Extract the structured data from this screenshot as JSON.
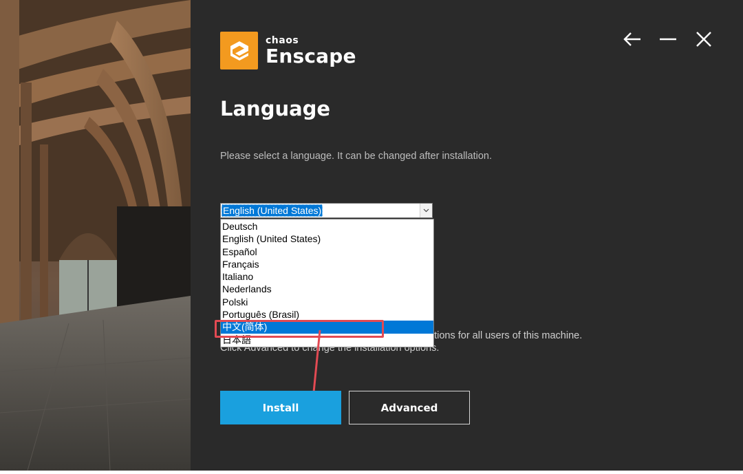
{
  "brand": {
    "company": "chaos",
    "product": "Enscape",
    "accent_color": "#f39a1f",
    "logo_icon": "enscape-logo-icon"
  },
  "window_controls": {
    "back_icon": "arrow-left-icon",
    "minimize_icon": "minimize-icon",
    "close_icon": "close-icon"
  },
  "page": {
    "title": "Language",
    "subtitle": "Please select a language. It can be changed after installation."
  },
  "language_select": {
    "selected": "English (United States)",
    "options": [
      "Deutsch",
      "English (United States)",
      "Español",
      "Français",
      "Italiano",
      "Nederlands",
      "Polski",
      "Português (Brasil)",
      "中文(简体)",
      "日本語"
    ],
    "highlighted_index": 8,
    "highlight_color": "#0078d7"
  },
  "info": {
    "line1_visible": "ptions for all users of this machine.",
    "line2_visible": "Click Advanced to change the installation options."
  },
  "buttons": {
    "install": "Install",
    "advanced": "Advanced",
    "install_color": "#1aa0de"
  },
  "annotation": {
    "color": "#e24a53"
  }
}
